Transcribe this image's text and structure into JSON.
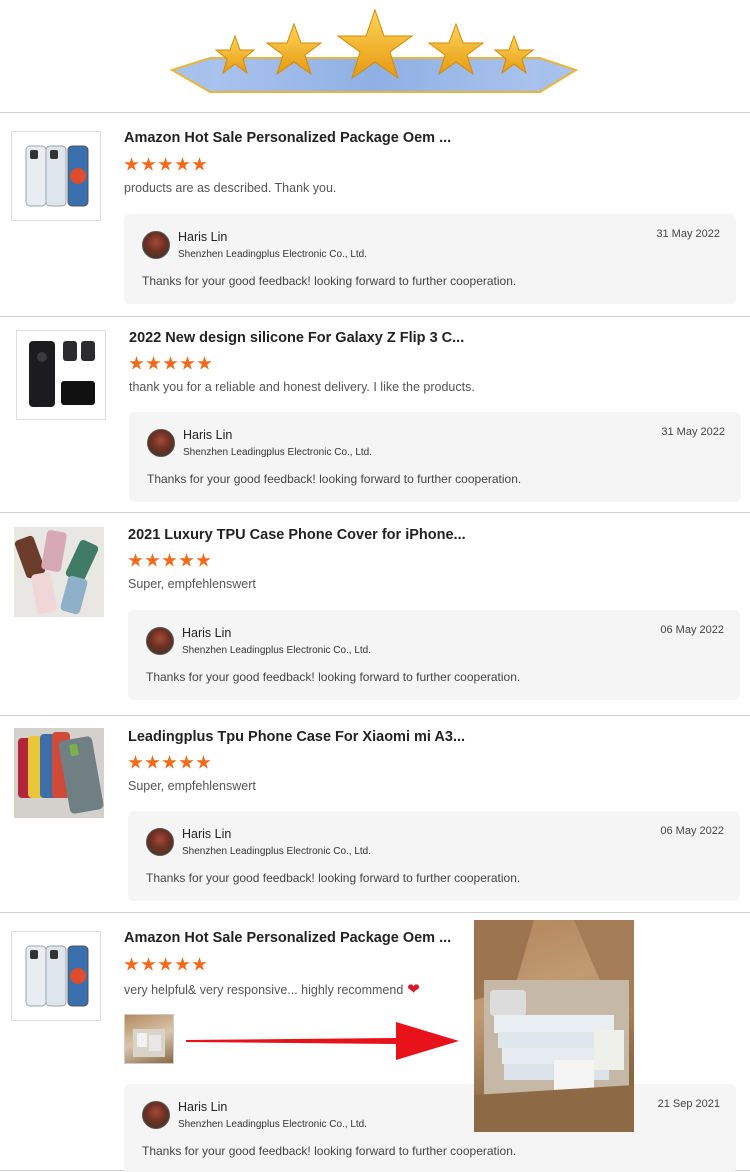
{
  "reviews": [
    {
      "title": "Amazon Hot Sale Personalized Package Oem ...",
      "rating": 5,
      "comment": "products are as described. Thank you.",
      "reply": {
        "seller": "Haris Lin",
        "company": "Shenzhen Leadingplus Electronic Co., Ltd.",
        "date": "31 May 2022",
        "text": "Thanks for your good feedback! looking forward to further cooperation."
      }
    },
    {
      "title": "2022 New design silicone For Galaxy Z Flip 3 C...",
      "rating": 5,
      "comment": "thank you for a reliable and honest delivery. I like the products.",
      "reply": {
        "seller": "Haris Lin",
        "company": "Shenzhen Leadingplus Electronic Co., Ltd.",
        "date": "31 May 2022",
        "text": "Thanks for your good feedback! looking forward to further cooperation."
      }
    },
    {
      "title": "2021 Luxury TPU Case Phone Cover for iPhone...",
      "rating": 5,
      "comment": "Super,  empfehlenswert",
      "reply": {
        "seller": "Haris Lin",
        "company": "Shenzhen Leadingplus Electronic Co., Ltd.",
        "date": "06 May 2022",
        "text": "Thanks for your good feedback! looking forward to further cooperation."
      }
    },
    {
      "title": "Leadingplus Tpu Phone Case For Xiaomi mi A3...",
      "rating": 5,
      "comment": "Super,  empfehlenswert",
      "reply": {
        "seller": "Haris Lin",
        "company": "Shenzhen Leadingplus Electronic Co., Ltd.",
        "date": "06 May 2022",
        "text": "Thanks for your good feedback! looking forward to further cooperation."
      }
    },
    {
      "title": "Amazon Hot Sale Personalized Package Oem ...",
      "rating": 5,
      "comment": "very helpful&  very responsive... highly recommend",
      "reply": {
        "seller": "Haris Lin",
        "company": "Shenzhen Leadingplus Electronic Co., Ltd.",
        "date": "21 Sep 2021",
        "text": "Thanks for your good feedback! looking forward to further cooperation."
      }
    }
  ],
  "colors": {
    "star": "#f26a1b",
    "arrow": "#e8121b",
    "heart": "#d8192a",
    "banner_star": "#f6b522",
    "banner_ribbon": "#9db8e6"
  }
}
